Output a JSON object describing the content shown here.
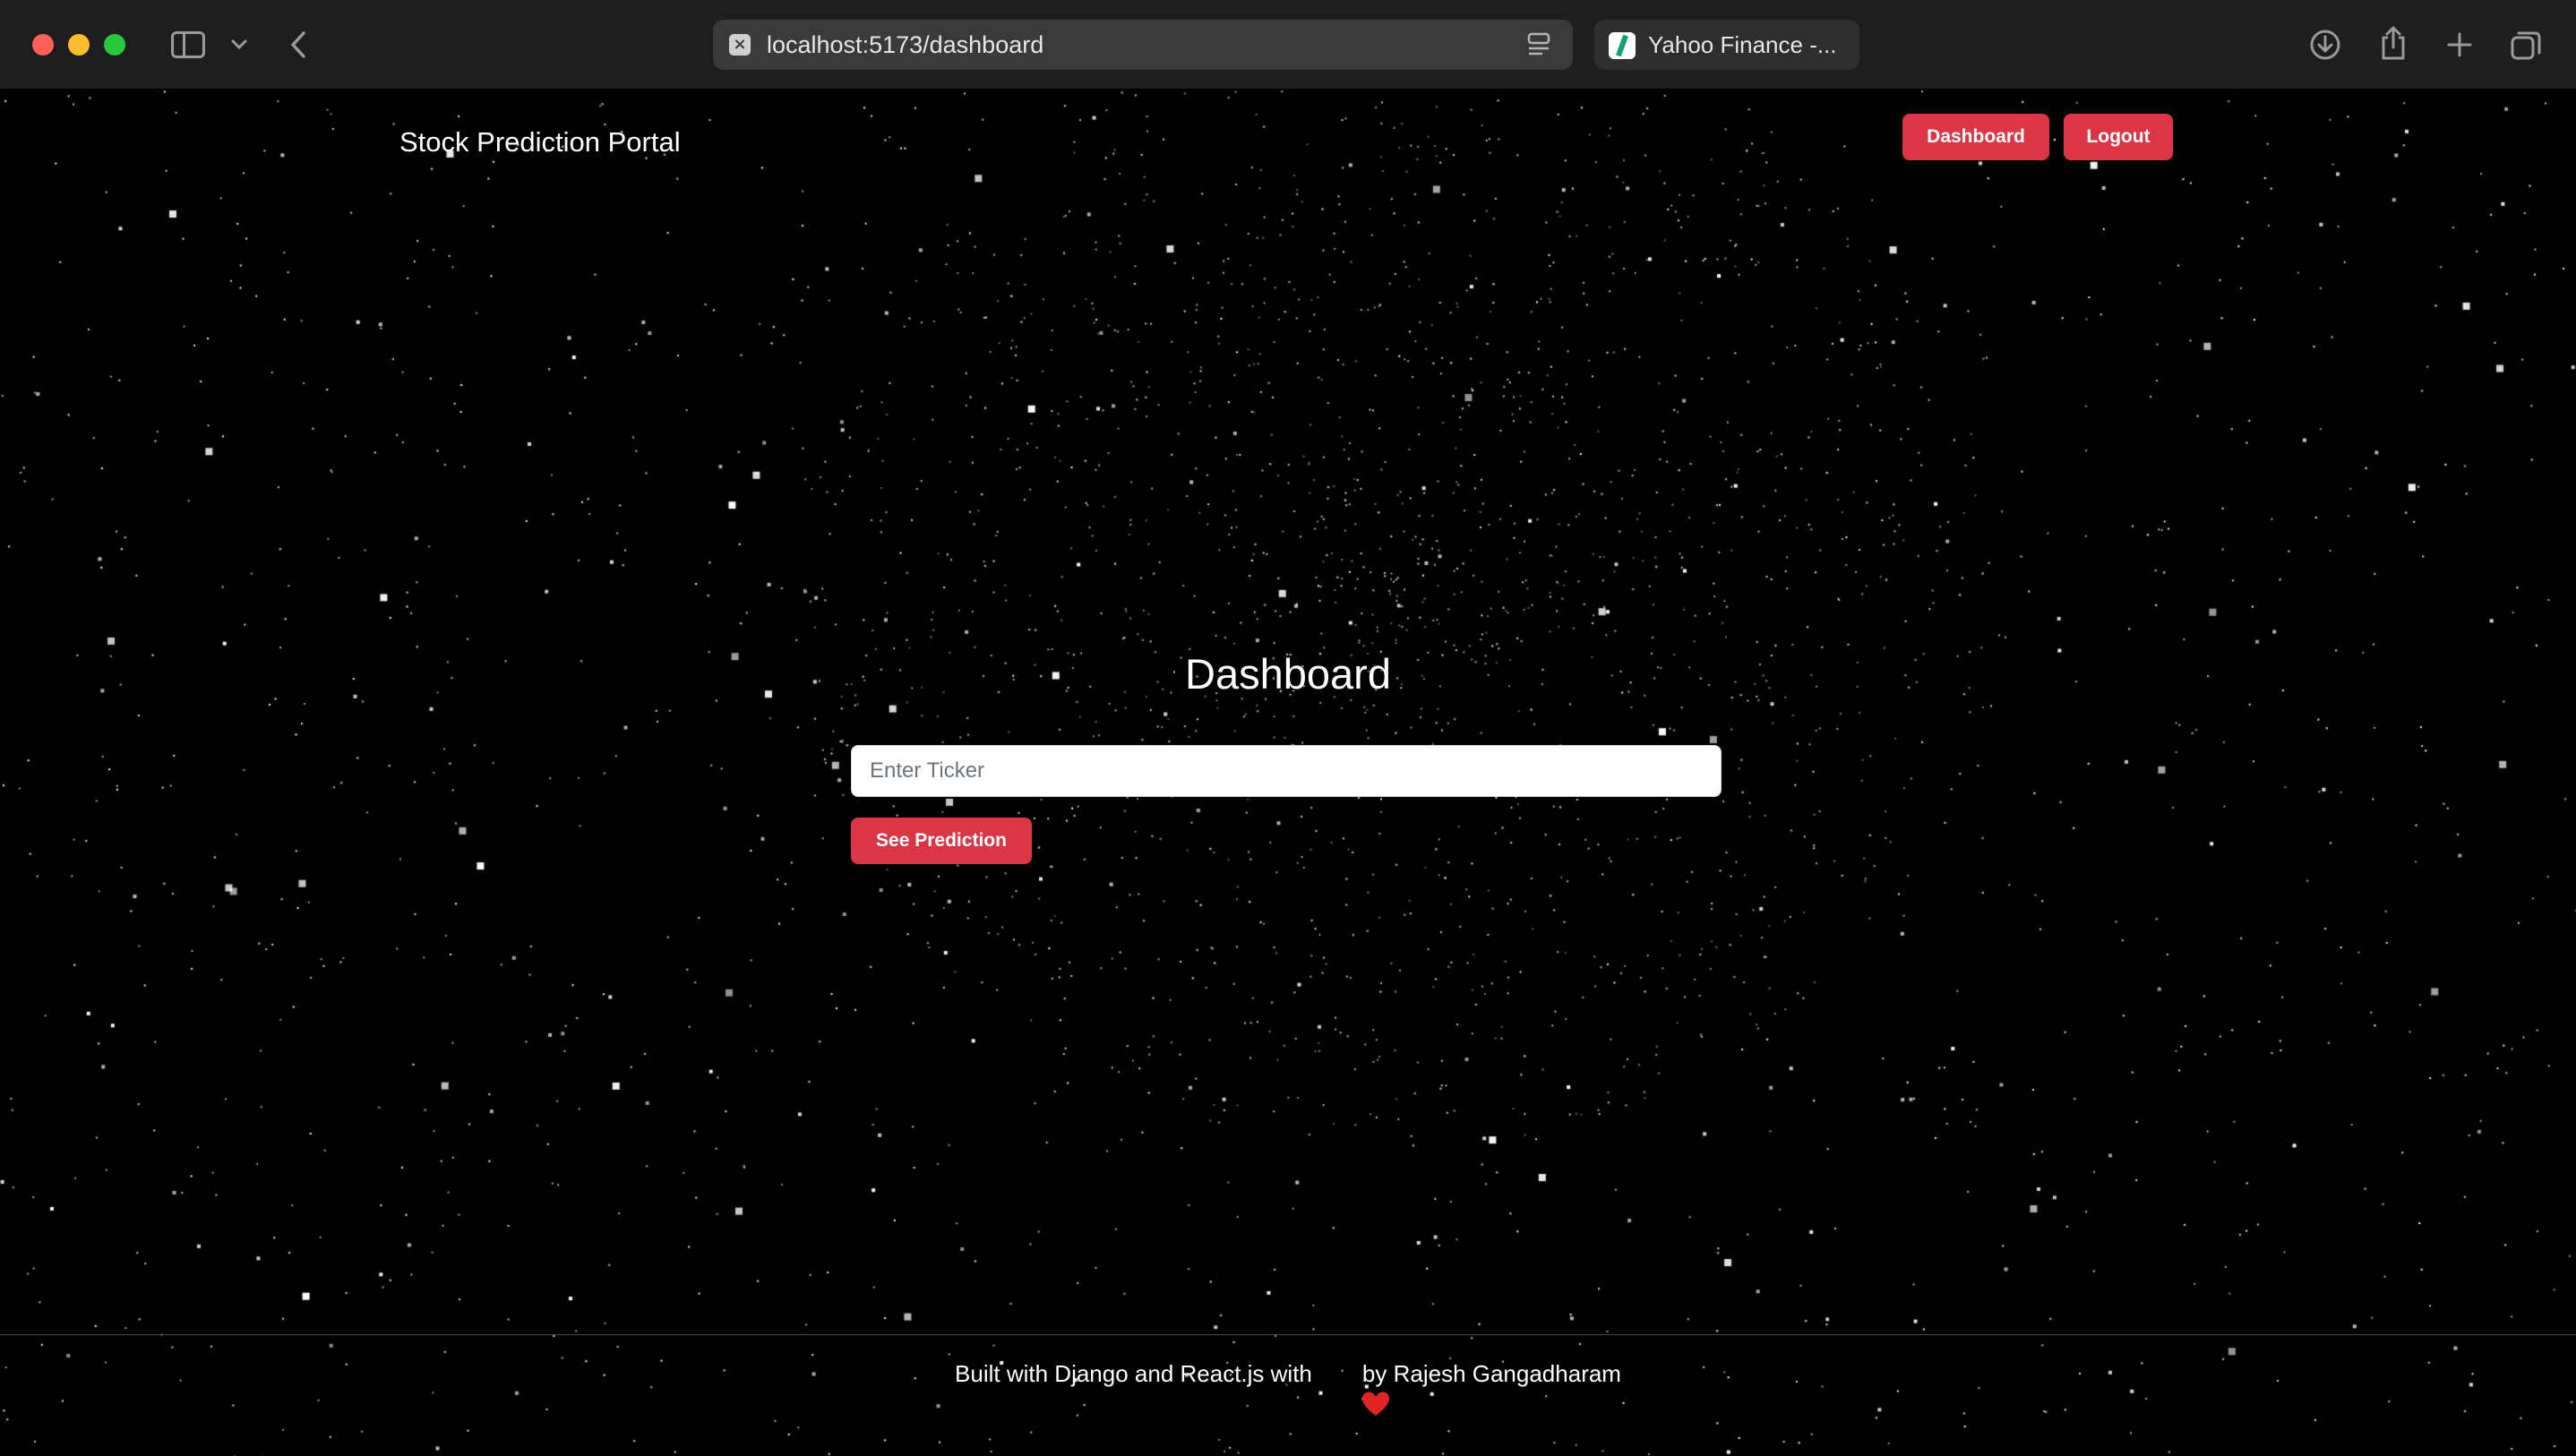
{
  "browser": {
    "url": "localhost:5173/dashboard",
    "second_tab_title": "Yahoo Finance -...",
    "icons": [
      "sidebar-icon",
      "chevron-down-icon",
      "back-arrow-icon",
      "reader-icon",
      "download-icon",
      "share-icon",
      "plus-icon",
      "tabs-overview-icon"
    ]
  },
  "navbar": {
    "brand": "Stock Prediction Portal",
    "dashboard_label": "Dashboard",
    "logout_label": "Logout"
  },
  "main": {
    "title": "Dashboard",
    "ticker_placeholder": "Enter Ticker",
    "ticker_value": "",
    "predict_label": "See Prediction"
  },
  "footer": {
    "text_before": "Built with Django and React.js with",
    "text_after": "by Rajesh Gangadharam",
    "icon": "heart-icon"
  },
  "colors": {
    "background": "#000000",
    "accent": "#dc3545",
    "heart": "#e02424"
  }
}
